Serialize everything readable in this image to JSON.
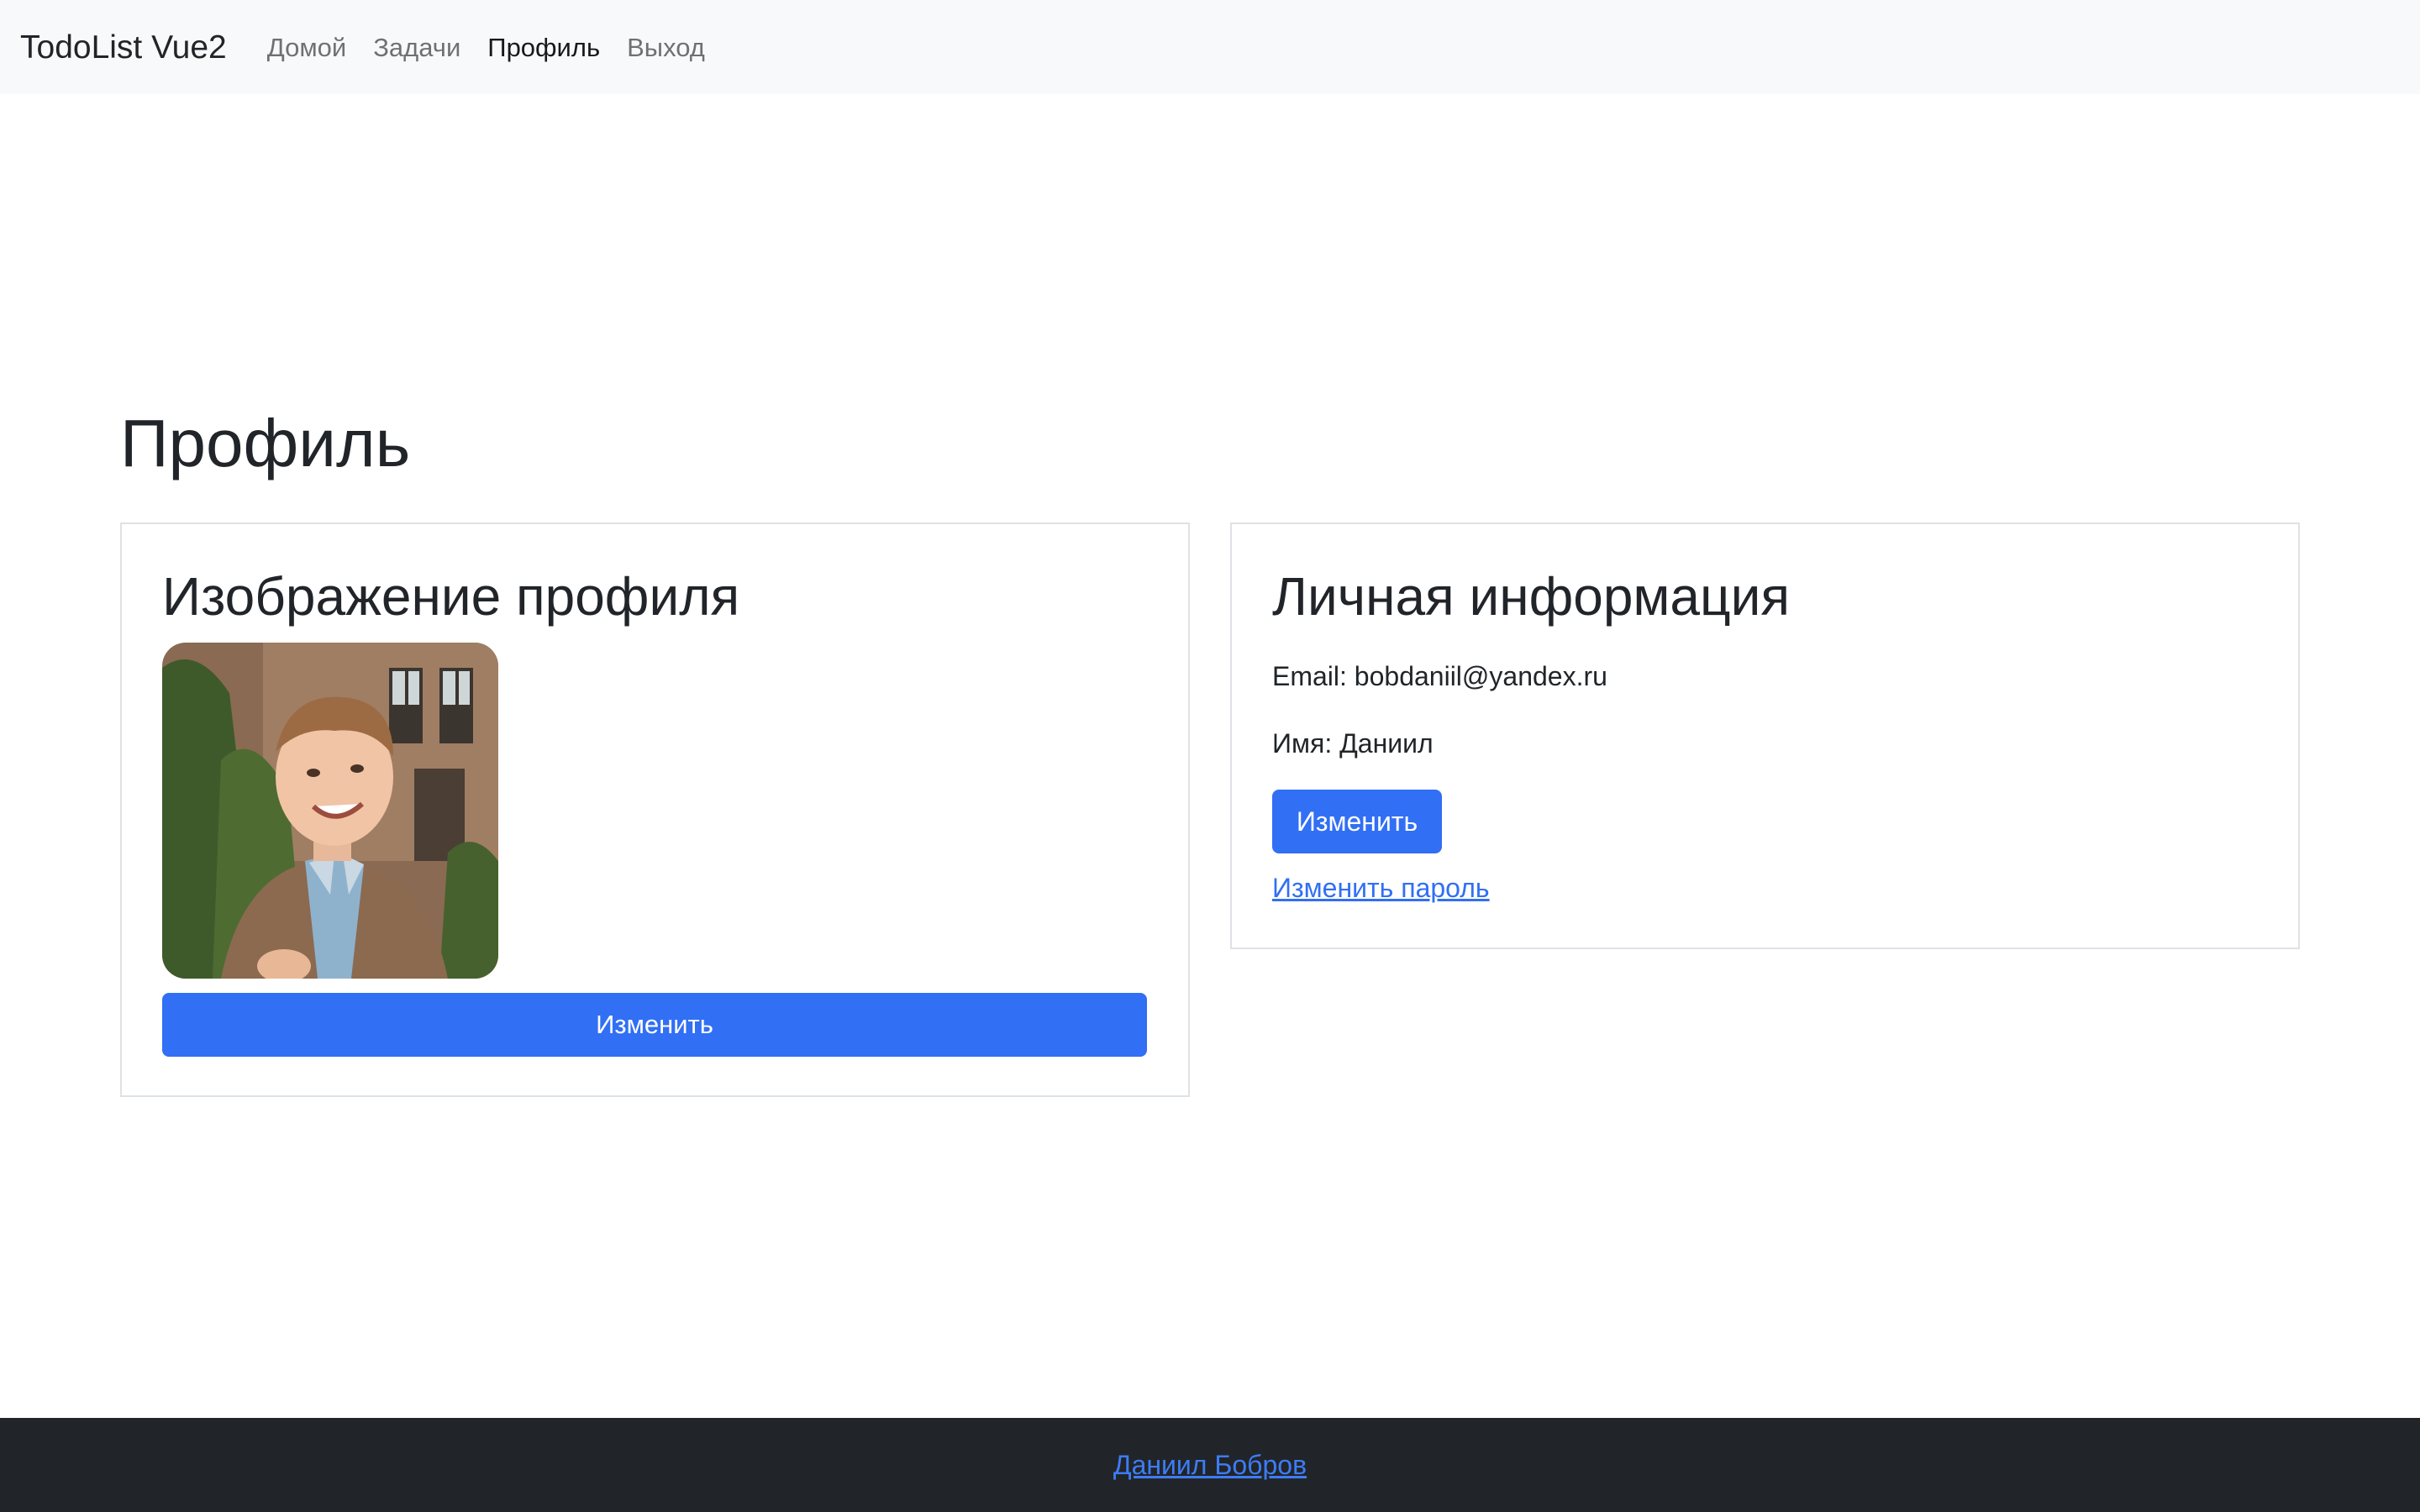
{
  "navbar": {
    "brand": "TodoList Vue2",
    "links": [
      {
        "label": "Домой",
        "active": false
      },
      {
        "label": "Задачи",
        "active": false
      },
      {
        "label": "Профиль",
        "active": true
      },
      {
        "label": "Выход",
        "active": false
      }
    ]
  },
  "page": {
    "title": "Профиль"
  },
  "profile_image_card": {
    "title": "Изображение профиля",
    "button_label": "Изменить"
  },
  "personal_info_card": {
    "title": "Личная информация",
    "email_line": "Email: bobdaniil@yandex.ru",
    "name_line": "Имя: Даниил",
    "button_label": "Изменить",
    "change_password_link": "Изменить пароль"
  },
  "footer": {
    "author_link": "Даниил Бобров"
  },
  "colors": {
    "primary": "#316ff4",
    "navbar_bg": "#f8f9fa",
    "footer_bg": "#212529",
    "border": "#dee2e6"
  }
}
